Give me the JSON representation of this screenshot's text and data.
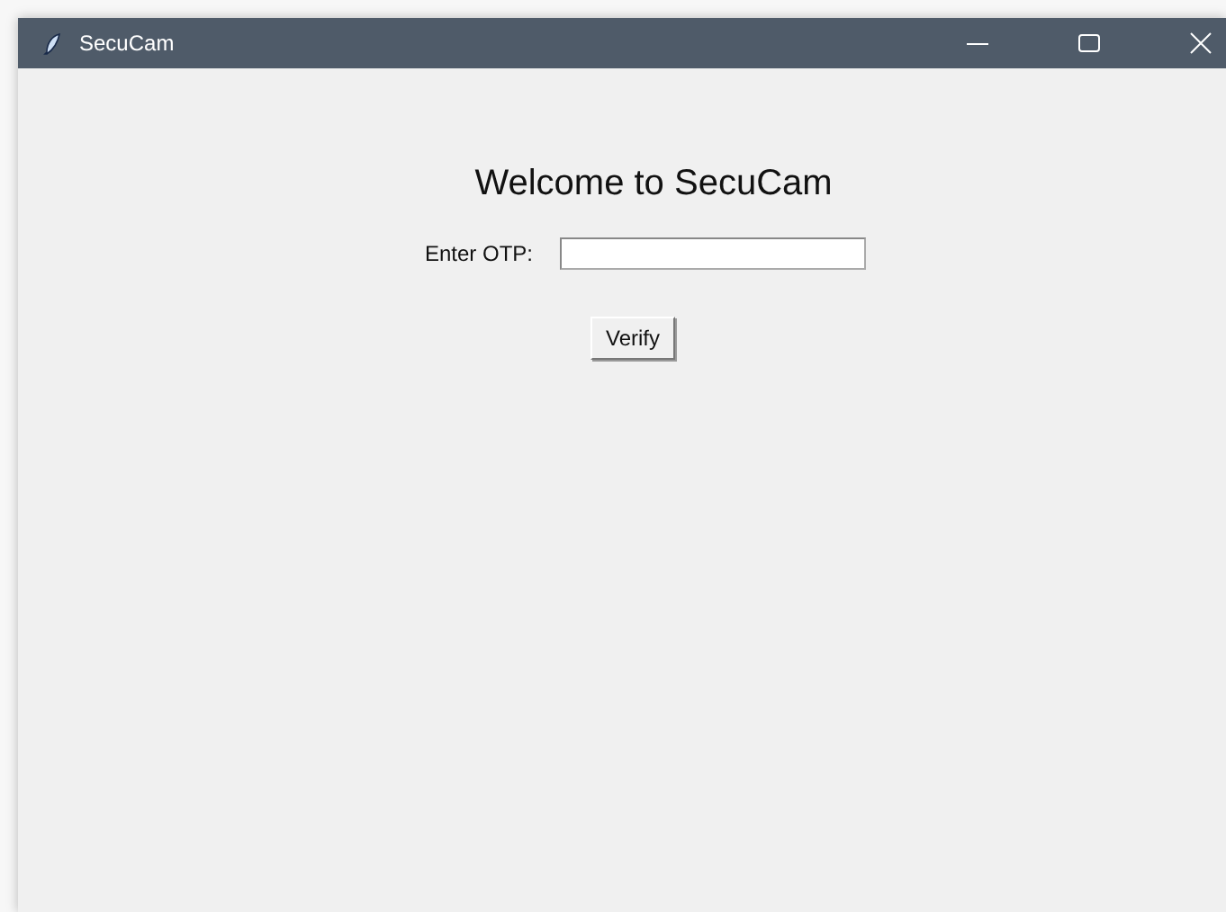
{
  "window": {
    "title": "SecuCam"
  },
  "heading": "Welcome to SecuCam",
  "otp": {
    "label": "Enter OTP:"
  },
  "buttons": [
    "Verify"
  ]
}
